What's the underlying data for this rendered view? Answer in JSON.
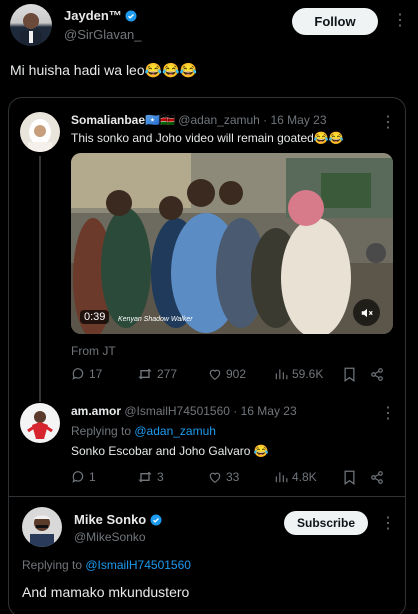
{
  "top_tweet": {
    "display_name": "Jayden™",
    "handle": "@SirGlavan_",
    "follow_label": "Follow",
    "text": "Mi huisha hadi wa leo😂😂😂"
  },
  "quoted": {
    "display_name": "Somalianbae🇸🇴🇰🇪",
    "meta": "@adan_zamuh · 16 May 23",
    "text": "This sonko and Joho video  will remain goated😂😂",
    "video_duration": "0:39",
    "video_caption": "Kenyan Shadow Walker",
    "from_label": "From JT",
    "replies": "17",
    "retweets": "277",
    "likes": "902",
    "views": "59.6K"
  },
  "reply1": {
    "display_name": "am.amor",
    "meta": "@IsmailH74501560 · 16 May 23",
    "replying_prefix": "Replying to ",
    "replying_handle": "@adan_zamuh",
    "text": "Sonko Escobar and Joho Galvaro 😂",
    "replies": "1",
    "retweets": "3",
    "likes": "33",
    "views": "4.8K"
  },
  "reply2": {
    "display_name": "Mike Sonko",
    "handle": "@MikeSonko",
    "subscribe_label": "Subscribe",
    "replying_prefix": "Replying to ",
    "replying_handle": "@IsmailH74501560",
    "text": "And mamako mkundustero"
  },
  "colors": {
    "accent": "#1d9bf0",
    "background": "#000000",
    "border": "#2f3336",
    "muted": "#71767b"
  }
}
